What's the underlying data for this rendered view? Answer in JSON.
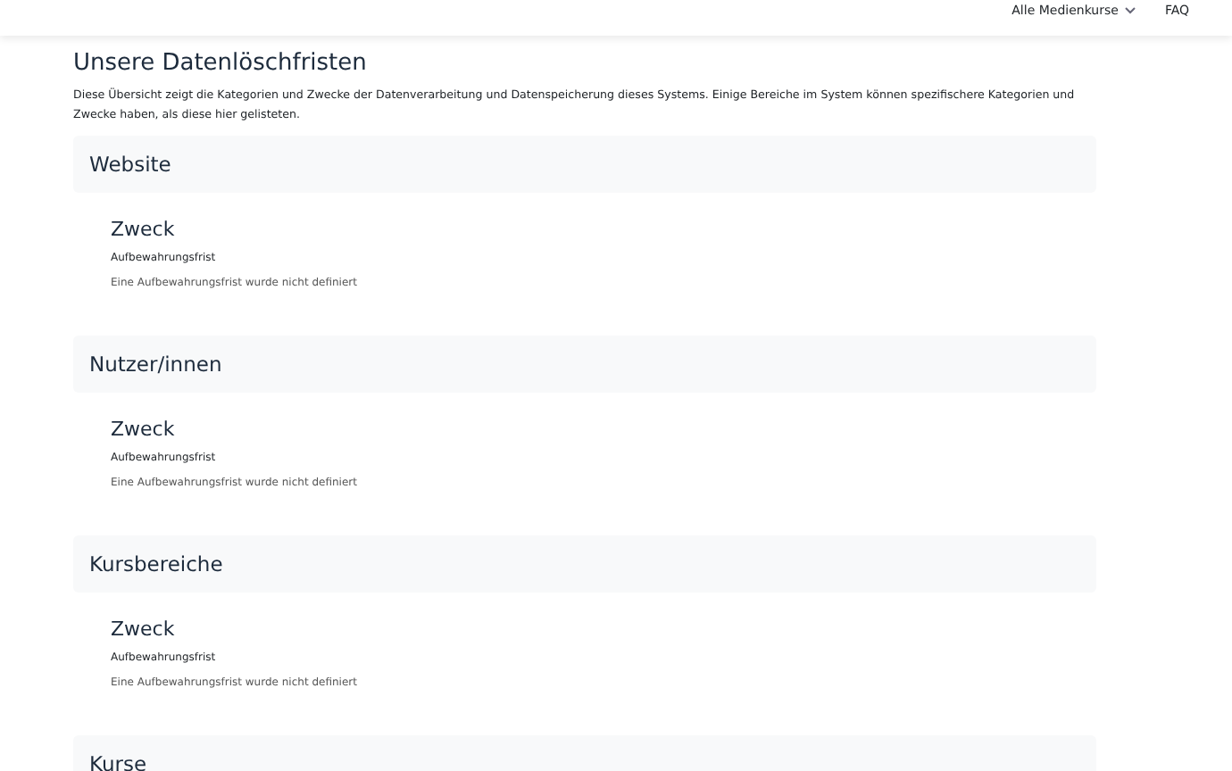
{
  "nav": {
    "items": [
      {
        "label": "Alle Medienkurse",
        "dropdown": true
      },
      {
        "label": "FAQ",
        "dropdown": false
      }
    ]
  },
  "title": "Unsere Datenlöschfristen",
  "description": "Diese Übersicht zeigt die Kategorien und Zwecke der Datenverarbeitung und Datenspeicherung dieses Systems. Einige Bereiche im System können spezifischere Kategorien und Zwecke haben, als diese hier gelisteten.",
  "sections": [
    {
      "heading": "Website",
      "purpose": "Zweck",
      "label": "Aufbewahrungsfrist",
      "value": "Eine Aufbewahrungsfrist wurde nicht definiert"
    },
    {
      "heading": "Nutzer/innen",
      "purpose": "Zweck",
      "label": "Aufbewahrungsfrist",
      "value": "Eine Aufbewahrungsfrist wurde nicht definiert"
    },
    {
      "heading": "Kursbereiche",
      "purpose": "Zweck",
      "label": "Aufbewahrungsfrist",
      "value": "Eine Aufbewahrungsfrist wurde nicht definiert"
    },
    {
      "heading": "Kurse"
    }
  ]
}
